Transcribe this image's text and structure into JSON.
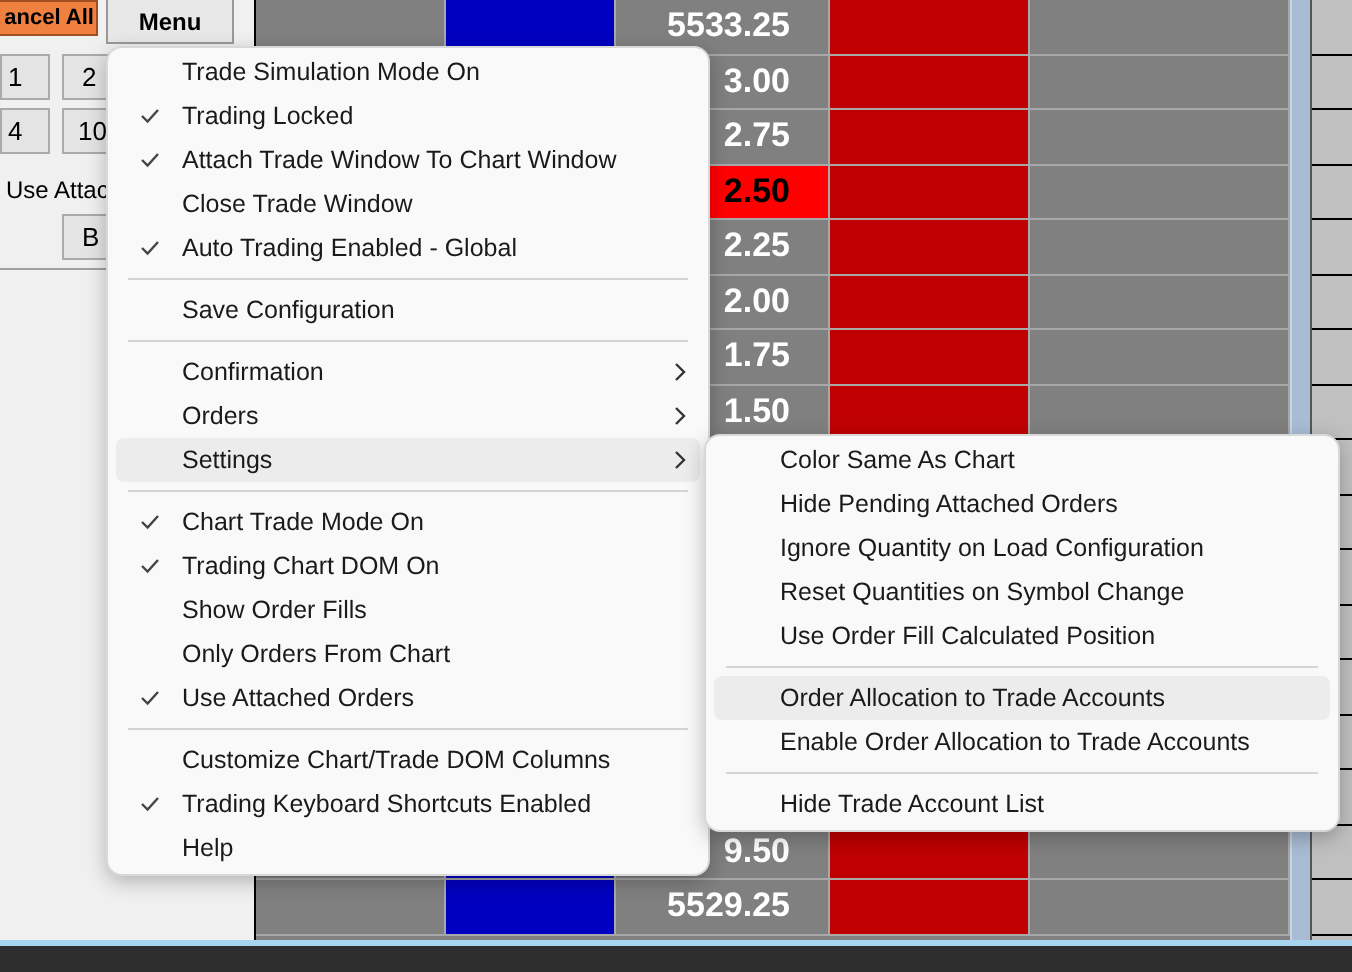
{
  "toolbar": {
    "cancel_button": "ancel All",
    "menu_button": "Menu"
  },
  "quantity_buttons": [
    [
      "1",
      "2"
    ],
    [
      "4",
      "10"
    ]
  ],
  "attached_label": "Use Attac",
  "side_button": "B",
  "dom_rows": [
    {
      "price": "5533.25",
      "highlighted": false
    },
    {
      "price": "3.00",
      "highlighted": false
    },
    {
      "price": "2.75",
      "highlighted": false
    },
    {
      "price": "2.50",
      "highlighted": true
    },
    {
      "price": "2.25",
      "highlighted": false
    },
    {
      "price": "2.00",
      "highlighted": false
    },
    {
      "price": "1.75",
      "highlighted": false
    },
    {
      "price": "1.50",
      "highlighted": false
    },
    {},
    {},
    {},
    {},
    {},
    {},
    {},
    {
      "price": "9.50",
      "highlighted": false
    },
    {
      "price": "5529.25",
      "highlighted": false
    }
  ],
  "menu": [
    {
      "kind": "item",
      "label": "Trade Simulation Mode On",
      "checked": false,
      "submenu": false,
      "selected": false
    },
    {
      "kind": "item",
      "label": "Trading Locked",
      "checked": true,
      "submenu": false,
      "selected": false
    },
    {
      "kind": "item",
      "label": "Attach Trade Window To Chart Window",
      "checked": true,
      "submenu": false,
      "selected": false
    },
    {
      "kind": "item",
      "label": "Close Trade Window",
      "checked": false,
      "submenu": false,
      "selected": false
    },
    {
      "kind": "item",
      "label": "Auto Trading Enabled - Global",
      "checked": true,
      "submenu": false,
      "selected": false
    },
    {
      "kind": "separator"
    },
    {
      "kind": "item",
      "label": "Save Configuration",
      "checked": false,
      "submenu": false,
      "selected": false
    },
    {
      "kind": "separator"
    },
    {
      "kind": "item",
      "label": "Confirmation",
      "checked": false,
      "submenu": true,
      "selected": false
    },
    {
      "kind": "item",
      "label": "Orders",
      "checked": false,
      "submenu": true,
      "selected": false
    },
    {
      "kind": "item",
      "label": "Settings",
      "checked": false,
      "submenu": true,
      "selected": true
    },
    {
      "kind": "separator"
    },
    {
      "kind": "item",
      "label": "Chart Trade Mode On",
      "checked": true,
      "submenu": false,
      "selected": false
    },
    {
      "kind": "item",
      "label": "Trading Chart DOM On",
      "checked": true,
      "submenu": false,
      "selected": false
    },
    {
      "kind": "item",
      "label": "Show Order Fills",
      "checked": false,
      "submenu": false,
      "selected": false
    },
    {
      "kind": "item",
      "label": "Only Orders From Chart",
      "checked": false,
      "submenu": false,
      "selected": false
    },
    {
      "kind": "item",
      "label": "Use Attached Orders",
      "checked": true,
      "submenu": false,
      "selected": false
    },
    {
      "kind": "separator"
    },
    {
      "kind": "item",
      "label": "Customize Chart/Trade DOM Columns",
      "checked": false,
      "submenu": false,
      "selected": false
    },
    {
      "kind": "item",
      "label": "Trading Keyboard Shortcuts Enabled",
      "checked": true,
      "submenu": false,
      "selected": false
    },
    {
      "kind": "item",
      "label": "Help",
      "checked": false,
      "submenu": false,
      "selected": false
    }
  ],
  "settings_submenu": [
    {
      "kind": "item",
      "label": "Color Same As Chart",
      "checked": false,
      "submenu": false,
      "selected": false
    },
    {
      "kind": "item",
      "label": "Hide Pending Attached Orders",
      "checked": false,
      "submenu": false,
      "selected": false
    },
    {
      "kind": "item",
      "label": "Ignore Quantity on Load Configuration",
      "checked": false,
      "submenu": false,
      "selected": false
    },
    {
      "kind": "item",
      "label": "Reset Quantities on Symbol Change",
      "checked": false,
      "submenu": false,
      "selected": false
    },
    {
      "kind": "item",
      "label": "Use Order Fill Calculated Position",
      "checked": false,
      "submenu": false,
      "selected": false
    },
    {
      "kind": "separator"
    },
    {
      "kind": "item",
      "label": "Order Allocation to Trade Accounts",
      "checked": false,
      "submenu": false,
      "selected": true
    },
    {
      "kind": "item",
      "label": "Enable Order Allocation to Trade Accounts",
      "checked": false,
      "submenu": false,
      "selected": false
    },
    {
      "kind": "separator"
    },
    {
      "kind": "item",
      "label": "Hide Trade Account List",
      "checked": false,
      "submenu": false,
      "selected": false
    }
  ]
}
